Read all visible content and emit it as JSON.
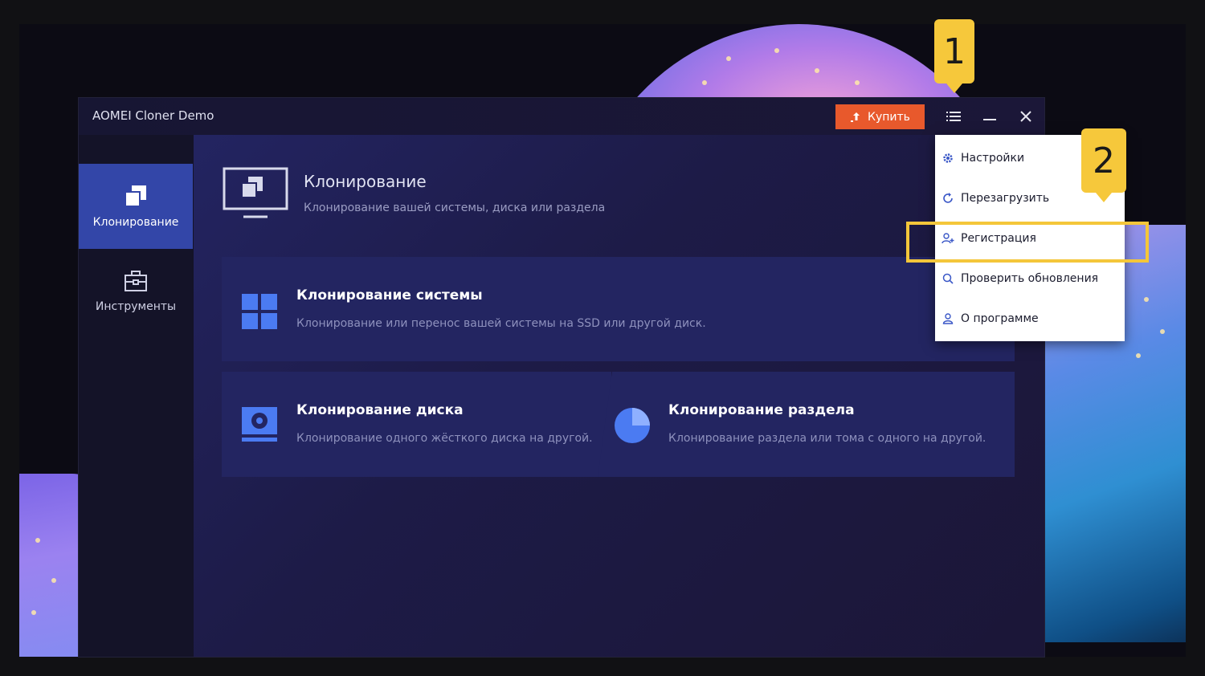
{
  "window": {
    "title": "AOMEI Cloner Demo",
    "buy_label": "Купить"
  },
  "sidebar": {
    "items": [
      {
        "label": "Клонирование",
        "active": true,
        "icon": "clone-icon"
      },
      {
        "label": "Инструменты",
        "active": false,
        "icon": "toolbox-icon"
      }
    ]
  },
  "header": {
    "title": "Клонирование",
    "subtitle": "Клонирование вашей системы, диска или раздела"
  },
  "cards": {
    "system": {
      "title": "Клонирование системы",
      "desc": "Клонирование или перенос вашей системы на SSD или другой диск."
    },
    "disk": {
      "title": "Клонирование диска",
      "desc": "Клонирование одного жёсткого диска на другой."
    },
    "partition": {
      "title": "Клонирование раздела",
      "desc": "Клонирование раздела или тома с одного на другой."
    }
  },
  "menu": {
    "items": [
      {
        "label": "Настройки",
        "icon": "gear-icon"
      },
      {
        "label": "Перезагрузить",
        "icon": "refresh-icon"
      },
      {
        "label": "Регистрация",
        "icon": "user-plus-icon"
      },
      {
        "label": "Проверить обновления",
        "icon": "search-icon"
      },
      {
        "label": "О программе",
        "icon": "user-icon"
      }
    ]
  },
  "callouts": {
    "one": "1",
    "two": "2"
  },
  "colors": {
    "accent": "#3346a8",
    "buy": "#e8592c",
    "callout": "#f6c83b"
  }
}
